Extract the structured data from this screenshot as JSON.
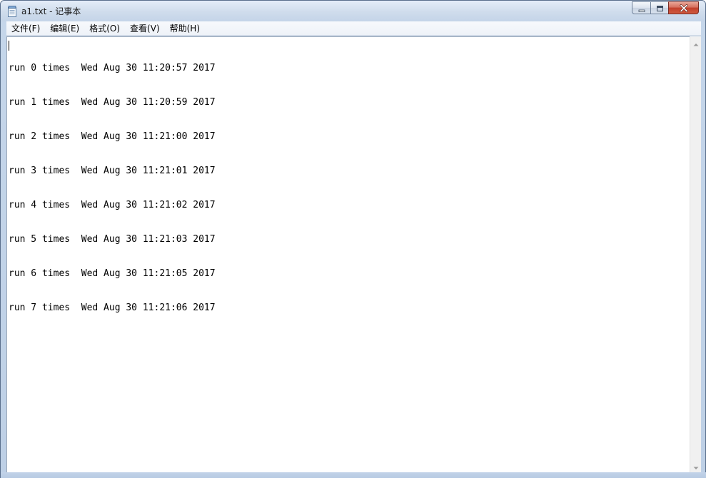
{
  "window": {
    "title": "a1.txt - 记事本"
  },
  "menu": {
    "items": [
      "文件(F)",
      "编辑(E)",
      "格式(O)",
      "查看(V)",
      "帮助(H)"
    ]
  },
  "document": {
    "lines": [
      "run 0 times  Wed Aug 30 11:20:57 2017",
      "run 1 times  Wed Aug 30 11:20:59 2017",
      "run 2 times  Wed Aug 30 11:21:00 2017",
      "run 3 times  Wed Aug 30 11:21:01 2017",
      "run 4 times  Wed Aug 30 11:21:02 2017",
      "run 5 times  Wed Aug 30 11:21:03 2017",
      "run 6 times  Wed Aug 30 11:21:05 2017",
      "run 7 times  Wed Aug 30 11:21:06 2017"
    ]
  },
  "icons": {
    "app": "notepad-icon",
    "minimize": "minimize-icon",
    "maximize": "maximize-icon",
    "close": "close-icon",
    "scroll_up": "scroll-up-arrow-icon",
    "scroll_down": "scroll-down-arrow-icon"
  },
  "colors": {
    "frame": "#c5d6ea",
    "close_button": "#c2402c",
    "editor_bg": "#ffffff",
    "text": "#000000"
  }
}
